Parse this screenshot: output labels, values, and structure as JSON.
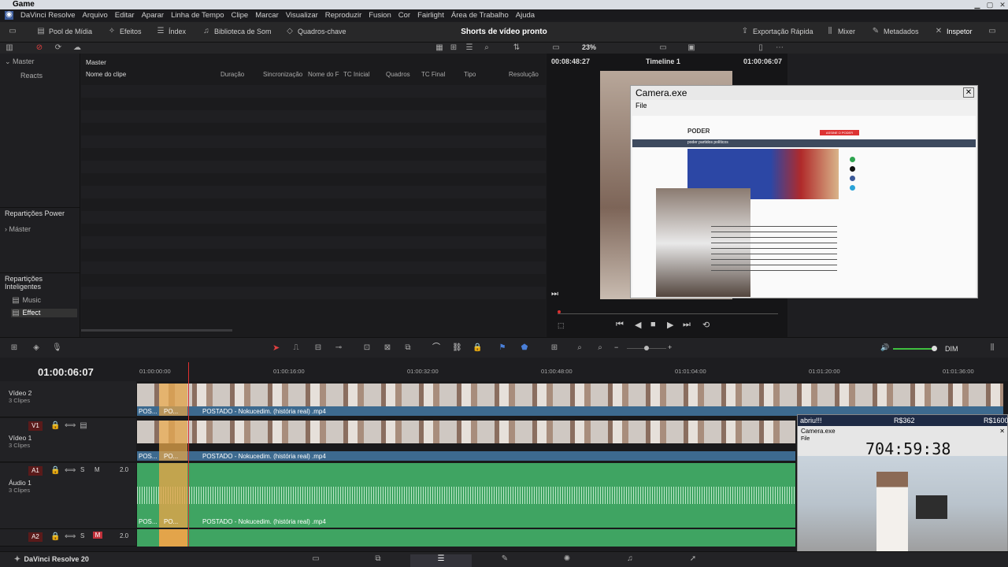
{
  "window": {
    "title": "Game"
  },
  "menu": [
    "DaVinci Resolve",
    "Arquivo",
    "Editar",
    "Aparar",
    "Linha de Tempo",
    "Clipe",
    "Marcar",
    "Visualizar",
    "Reproduzir",
    "Fusion",
    "Cor",
    "Fairlight",
    "Área de Trabalho",
    "Ajuda"
  ],
  "toolbar": {
    "media_pool": "Pool de Mídia",
    "effects": "Efeitos",
    "index": "Índex",
    "sound_library": "Biblioteca de Som",
    "keyframes": "Quadros-chave",
    "project_title": "Shorts de vídeo pronto",
    "quick_export": "Exportação Rápida",
    "mixer": "Mixer",
    "metadata": "Metadados",
    "inspector": "Inspetor"
  },
  "subbar": {
    "zoom": "23%",
    "source_tc": "00:08:48:27",
    "timeline_name": "Timeline 1",
    "record_tc": "01:00:06:07"
  },
  "bin": {
    "master": "Master",
    "reacts": "Reacts",
    "power_bins": "Repartições Power",
    "power_master": "Máster",
    "smart_bins": "Repartições Inteligentes",
    "smart_items": [
      "Music",
      "Effect"
    ]
  },
  "media": {
    "folder": "Master",
    "columns": [
      "Nome do clipe",
      "Duração",
      "Sincronização",
      "Nome do F",
      "TC Inicial",
      "Quadros",
      "TC Final",
      "Tipo",
      "Resolução"
    ]
  },
  "camera_window": {
    "title": "Camera.exe",
    "menu": "File",
    "site_logo": "PODER",
    "nav_label": "poder partidos políticos",
    "subscribe": "ASSINE O PODER GRÁTIS"
  },
  "timeline": {
    "timecode": "01:00:06:07",
    "ruler": [
      "01:00:00:00",
      "01:00:16:00",
      "01:00:32:00",
      "01:00:48:00",
      "01:01:04:00",
      "01:01:20:00",
      "01:01:36:00"
    ],
    "tracks": [
      {
        "name": "Vídeo 2",
        "sub": "3 Clipes",
        "clip": "POSTADO - Nokucedim. (história real) .mp4",
        "short1": "POS...",
        "short2": "PO..."
      },
      {
        "name": "Vídeo 1",
        "sub": "3 Clipes",
        "badge": "V1",
        "clip": "POSTADO - Nokucedim. (história real) .mp4",
        "short1": "POS...",
        "short2": "PO..."
      },
      {
        "name": "Áudio 1",
        "sub": "3 Clipes",
        "badge": "A1",
        "level": "2.0",
        "clip": "POSTADO - Nokucedim. (história real) .mp4",
        "short1": "POS...",
        "short2": "PO..."
      },
      {
        "name": "",
        "sub": "",
        "badge": "A2",
        "level": "2.0"
      }
    ],
    "dim_label": "DIM"
  },
  "overlay": {
    "message": "abriu!!!",
    "price1": "R$362",
    "price2": "R$1600",
    "window_title": "Camera.exe",
    "menu": "File",
    "timer": "704:59:38"
  },
  "footer": {
    "app": "DaVinci Resolve 20"
  },
  "colors": {
    "accent_clip": "#3d6a8f",
    "audio": "#3fa462",
    "orange": "#e3a44a",
    "playhead": "#e03030"
  }
}
